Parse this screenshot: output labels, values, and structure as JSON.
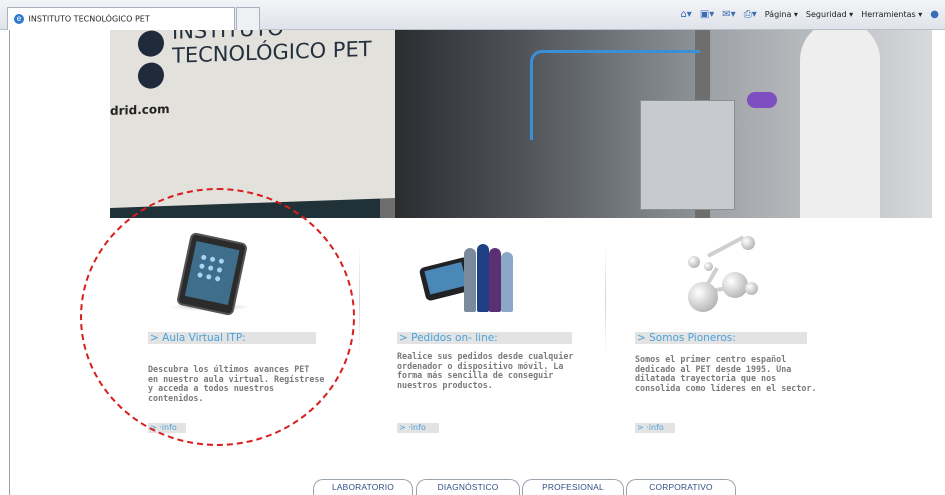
{
  "browser": {
    "tab_title": "INSTITUTO TECNOLÓGICO PET",
    "toolbar": {
      "pagina": "Página",
      "seguridad": "Seguridad",
      "herramientas": "Herramientas"
    }
  },
  "hero": {
    "poster_line1": "INSTITUTO",
    "poster_line2": "TECNOLÓGICO PET",
    "poster_url": "drid.com"
  },
  "columns": [
    {
      "heading": "> Aula Virtual ITP:",
      "description": "Descubra los últimos avances PET\nen nuestro aula virtual. Regístrese\ny acceda a todos nuestros\ncontenidos.",
      "info_label": "> ·info",
      "icon": "tablet-icon"
    },
    {
      "heading": "> Pedidos on- line:",
      "description": "Realice sus pedidos desde cualquier\nordenador o dispositivo móvil. La\nforma más sencilla de conseguir\nnuestros productos.",
      "info_label": "> ·info",
      "icon": "phone-bottles-icon"
    },
    {
      "heading": "> Somos Pioneros:",
      "description": "Somos el primer centro español\ndedicado al PET desde 1995. Una\ndilatada trayectoria que nos\nconsolida como líderes en el sector.",
      "info_label": "> ·info",
      "icon": "molecule-icon"
    }
  ],
  "nav": {
    "tabs": [
      "LABORATORIO",
      "DIAGNÓSTICO",
      "PROFESIONAL",
      "CORPORATIVO"
    ]
  },
  "colors": {
    "heading_blue": "#4ba3d9",
    "annotation_red": "#d81e1e",
    "nav_text": "#2f4f86"
  }
}
